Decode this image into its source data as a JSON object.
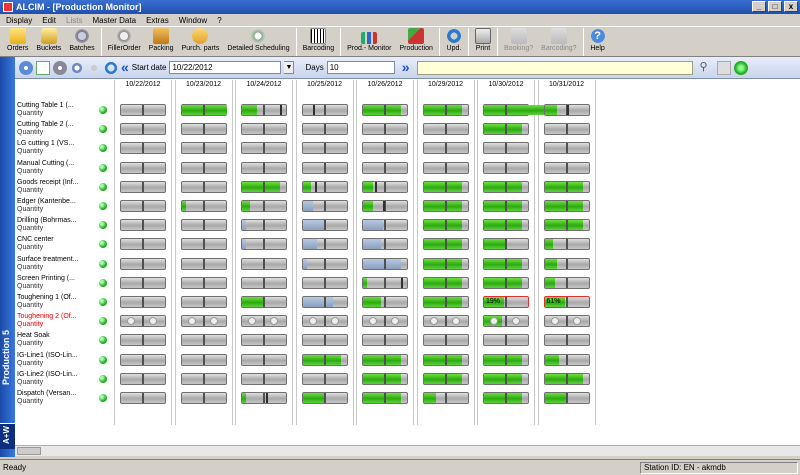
{
  "window": {
    "title": "ALCIM - [Production Monitor]",
    "buttons": [
      "_",
      "□",
      "x"
    ],
    "mdi_buttons": [
      "_",
      "□",
      "x"
    ]
  },
  "menu": [
    {
      "label": "Display",
      "enabled": true
    },
    {
      "label": "Edit",
      "enabled": true
    },
    {
      "label": "Lists",
      "enabled": false
    },
    {
      "label": "Master Data",
      "enabled": true
    },
    {
      "label": "Extras",
      "enabled": true
    },
    {
      "label": "Window",
      "enabled": true
    },
    {
      "label": "?",
      "enabled": true
    }
  ],
  "toolbar": [
    {
      "label": "Orders",
      "icon": "folder-icon",
      "enabled": true
    },
    {
      "label": "Buckets",
      "icon": "buckets-icon",
      "enabled": true
    },
    {
      "label": "Batches",
      "icon": "gear-icon",
      "enabled": true
    },
    {
      "sep": true
    },
    {
      "label": "FillerOrder",
      "icon": "gear-icon",
      "enabled": true
    },
    {
      "label": "Packing",
      "icon": "box-icon",
      "enabled": true
    },
    {
      "label": "Purch. parts",
      "icon": "parts-icon",
      "enabled": true
    },
    {
      "label": "Detailed Scheduling",
      "icon": "schedule-icon",
      "enabled": true
    },
    {
      "sep": true
    },
    {
      "label": "Barcoding",
      "icon": "barcode-icon",
      "enabled": true
    },
    {
      "sep": true
    },
    {
      "label": "Prod.- Monitor",
      "icon": "monitor-icon",
      "enabled": true
    },
    {
      "label": "Production",
      "icon": "production-icon",
      "enabled": true
    },
    {
      "sep": true
    },
    {
      "label": "Upd.",
      "icon": "update-icon",
      "enabled": true
    },
    {
      "sep": true
    },
    {
      "label": "Print",
      "icon": "print-icon",
      "enabled": true
    },
    {
      "sep": true
    },
    {
      "label": "Booking?",
      "icon": "book-icon",
      "enabled": false
    },
    {
      "label": "Barcoding?",
      "icon": "book-icon",
      "enabled": false
    },
    {
      "sep": true
    },
    {
      "label": "Help",
      "icon": "help-icon",
      "enabled": true
    }
  ],
  "sidebar": {
    "title": "Production 5",
    "logo": "A+W"
  },
  "filter": {
    "start_label": "Start date",
    "start_value": "10/22/2012",
    "days_label": "Days",
    "days_value": "10"
  },
  "dates": [
    "10/22/2012",
    "10/23/2012",
    "10/24/2012",
    "10/25/2012",
    "10/26/2012",
    "10/29/2012",
    "10/30/2012",
    "10/31/2012"
  ],
  "rows": [
    {
      "name": "Cutting Table 1 (...",
      "sub": "Quantity",
      "red": false,
      "cells": [
        [
          "e"
        ],
        [
          "g",
          45,
          "e"
        ],
        [
          "g",
          15,
          "l",
          38
        ],
        [
          "e",
          0,
          "l",
          10
        ],
        [
          "g",
          38
        ],
        [
          "g",
          38
        ],
        [
          "g",
          60
        ],
        [
          "g",
          12,
          "l",
          22
        ]
      ]
    },
    {
      "name": "Cutting Table 2 (...",
      "sub": "Quantity",
      "red": false,
      "cells": [
        [
          "e"
        ],
        [
          "e"
        ],
        [
          "e"
        ],
        [
          "e"
        ],
        [
          "e"
        ],
        [
          "e"
        ],
        [
          "g",
          38
        ],
        [
          "e"
        ]
      ]
    },
    {
      "name": "LG cutting 1 (VS...",
      "sub": "Quantity",
      "red": false,
      "cells": [
        [
          "e"
        ],
        [
          "e"
        ],
        [
          "e"
        ],
        [
          "e"
        ],
        [
          "e"
        ],
        [
          "e"
        ],
        [
          "e"
        ],
        [
          "e"
        ]
      ]
    },
    {
      "name": "Manual Cutting (...",
      "sub": "Quantity",
      "red": false,
      "cells": [
        [
          "e"
        ],
        [
          "e"
        ],
        [
          "e"
        ],
        [
          "e"
        ],
        [
          "e"
        ],
        [
          "e"
        ],
        [
          "e"
        ],
        [
          "e"
        ]
      ]
    },
    {
      "name": "Goods receipt (Inf...",
      "sub": "Quantity",
      "red": false,
      "cells": [
        [
          "e"
        ],
        [
          "e"
        ],
        [
          "g",
          38
        ],
        [
          "g",
          8,
          "l",
          12
        ],
        [
          "g",
          10,
          "l",
          12
        ],
        [
          "g",
          38
        ],
        [
          "g",
          38
        ],
        [
          "g",
          38
        ]
      ]
    },
    {
      "name": "Edger (Kantenbe...",
      "sub": "Quantity",
      "red": false,
      "cells": [
        [
          "e"
        ],
        [
          "g",
          4
        ],
        [
          "g",
          8
        ],
        [
          "b",
          10
        ],
        [
          "g",
          10,
          "l",
          20
        ],
        [
          "g",
          38
        ],
        [
          "g",
          38
        ],
        [
          "g",
          38
        ]
      ]
    },
    {
      "name": "Drilling (Bohrmas...",
      "sub": "Quantity",
      "red": false,
      "cells": [
        [
          "e"
        ],
        [
          "e"
        ],
        [
          "b",
          4
        ],
        [
          "b",
          22
        ],
        [
          "b",
          20
        ],
        [
          "g",
          38
        ],
        [
          "g",
          38
        ],
        [
          "g",
          38
        ]
      ]
    },
    {
      "name": "CNC center",
      "sub": "Quantity",
      "red": false,
      "cells": [
        [
          "e"
        ],
        [
          "e"
        ],
        [
          "b",
          4
        ],
        [
          "b",
          14
        ],
        [
          "b",
          18
        ],
        [
          "g",
          38
        ],
        [
          "g",
          22
        ],
        [
          "g",
          8
        ]
      ]
    },
    {
      "name": "Surface treatment...",
      "sub": "Quantity",
      "red": false,
      "cells": [
        [
          "e"
        ],
        [
          "e"
        ],
        [
          "e"
        ],
        [
          "b",
          4
        ],
        [
          "b",
          38
        ],
        [
          "g",
          38
        ],
        [
          "g",
          38
        ],
        [
          "g",
          12
        ]
      ]
    },
    {
      "name": "Screen Printing (...",
      "sub": "Quantity",
      "red": false,
      "cells": [
        [
          "e"
        ],
        [
          "e"
        ],
        [
          "e"
        ],
        [
          "e"
        ],
        [
          "g",
          4,
          "l",
          38
        ],
        [
          "g",
          38
        ],
        [
          "g",
          38
        ],
        [
          "g",
          10
        ]
      ]
    },
    {
      "name": "Toughening 1 (Of...",
      "sub": "Quantity",
      "red": false,
      "cells": [
        [
          "e"
        ],
        [
          "e"
        ],
        [
          "g",
          22
        ],
        [
          "b",
          30
        ],
        [
          "g",
          18
        ],
        [
          "g",
          38
        ],
        [
          "pct",
          "19%"
        ],
        [
          "pct",
          "61%"
        ]
      ]
    },
    {
      "name": "Toughening 2 (Of...",
      "sub": "Quantity",
      "red": true,
      "cells": [
        [
          "m"
        ],
        [
          "m"
        ],
        [
          "m"
        ],
        [
          "m"
        ],
        [
          "m"
        ],
        [
          "m"
        ],
        [
          "mg"
        ],
        [
          "m"
        ]
      ]
    },
    {
      "name": "Heat Soak",
      "sub": "Quantity",
      "red": false,
      "cells": [
        [
          "e"
        ],
        [
          "e"
        ],
        [
          "e"
        ],
        [
          "e"
        ],
        [
          "e"
        ],
        [
          "e"
        ],
        [
          "e"
        ],
        [
          "e"
        ]
      ]
    },
    {
      "name": "IG-Line1 (ISO-Lin...",
      "sub": "Quantity",
      "red": false,
      "cells": [
        [
          "e"
        ],
        [
          "e"
        ],
        [
          "e"
        ],
        [
          "g",
          38
        ],
        [
          "g",
          38
        ],
        [
          "g",
          38
        ],
        [
          "g",
          38
        ],
        [
          "g",
          14
        ]
      ]
    },
    {
      "name": "IG-Line2 (ISO-Lin...",
      "sub": "Quantity",
      "red": false,
      "cells": [
        [
          "e"
        ],
        [
          "e"
        ],
        [
          "e"
        ],
        [
          "e"
        ],
        [
          "g",
          38
        ],
        [
          "g",
          38
        ],
        [
          "g",
          38
        ],
        [
          "g",
          38
        ]
      ]
    },
    {
      "name": "Dispatch (Versan...",
      "sub": "Quantity",
      "red": false,
      "cells": [
        [
          "e"
        ],
        [
          "e"
        ],
        [
          "g",
          4,
          "l",
          24
        ],
        [
          "g",
          22
        ],
        [
          "g",
          38
        ],
        [
          "g",
          12
        ],
        [
          "g",
          38
        ],
        [
          "g",
          22
        ]
      ]
    }
  ],
  "statusbar": {
    "left": "Ready",
    "right": "Station ID: EN - akmdb"
  }
}
